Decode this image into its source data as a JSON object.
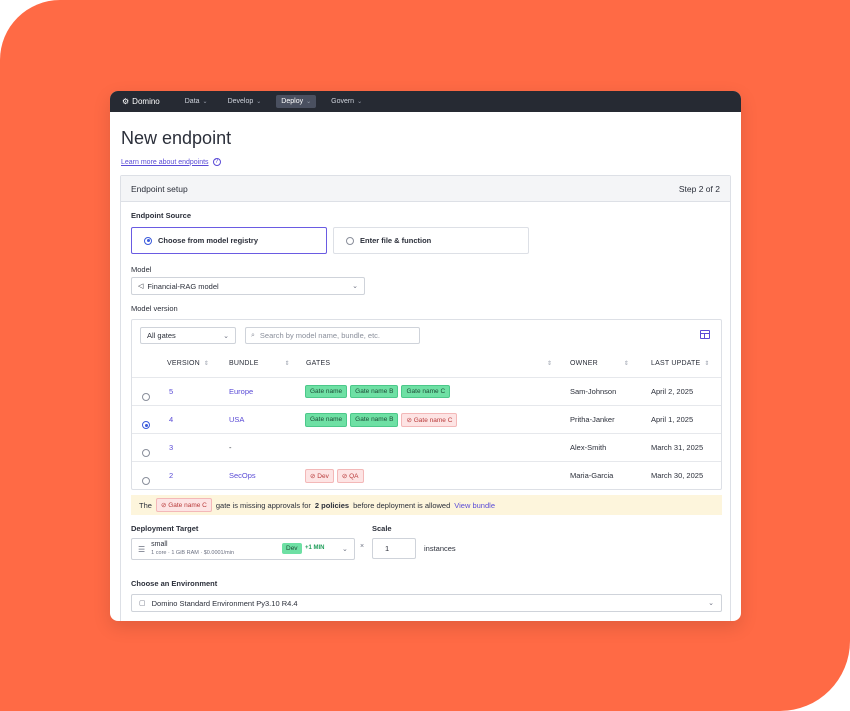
{
  "nav": {
    "brand": "Domino",
    "items": [
      {
        "label": "Data",
        "active": false
      },
      {
        "label": "Develop",
        "active": false
      },
      {
        "label": "Deploy",
        "active": true
      },
      {
        "label": "Govern",
        "active": false
      }
    ]
  },
  "page": {
    "title": "New endpoint",
    "learn_link": "Learn more about endpoints"
  },
  "panel": {
    "title": "Endpoint setup",
    "step": "Step 2 of 2"
  },
  "source": {
    "label": "Endpoint Source",
    "options": [
      {
        "label": "Choose from model registry",
        "selected": true
      },
      {
        "label": "Enter file & function",
        "selected": false
      }
    ]
  },
  "model": {
    "label": "Model",
    "value": "Financial-RAG model"
  },
  "version": {
    "label": "Model version",
    "filter": "All gates",
    "search_placeholder": "Search by model name, bundle, etc.",
    "columns": [
      "VERSION",
      "BUNDLE",
      "GATES",
      "OWNER",
      "LAST UPDATE"
    ],
    "rows": [
      {
        "version": "5",
        "bundle": "Europe",
        "owner": "Sam-Johnson",
        "updated": "April 2, 2025",
        "selected": false,
        "gates": [
          {
            "label": "Gate name",
            "status": "pass"
          },
          {
            "label": "Gate name B",
            "status": "pass"
          },
          {
            "label": "Gate name C",
            "status": "pass"
          }
        ]
      },
      {
        "version": "4",
        "bundle": "USA",
        "owner": "Pritha-Janker",
        "updated": "April 1, 2025",
        "selected": true,
        "gates": [
          {
            "label": "Gate name",
            "status": "pass"
          },
          {
            "label": "Gate name B",
            "status": "pass"
          },
          {
            "label": "Gate name C",
            "status": "blocked"
          }
        ]
      },
      {
        "version": "3",
        "bundle": "-",
        "owner": "Alex-Smith",
        "updated": "March 31, 2025",
        "selected": false,
        "gates": []
      },
      {
        "version": "2",
        "bundle": "SecOps",
        "owner": "Maria-Garcia",
        "updated": "March 30, 2025",
        "selected": false,
        "gates": [
          {
            "label": "Dev",
            "status": "blocked"
          },
          {
            "label": "QA",
            "status": "blocked"
          }
        ]
      }
    ]
  },
  "banner": {
    "prefix": "The",
    "gate": "Gate name C",
    "middle": "gate is missing approvals for",
    "bold": "2 policies",
    "suffix": "before deployment is allowed",
    "link": "View bundle"
  },
  "deployment": {
    "label": "Deployment Target",
    "name": "small",
    "spec": "1 core · 1 GiB RAM · $0.0001/min",
    "tag": "Dev",
    "min": "+1 MIN"
  },
  "scale": {
    "label": "Scale",
    "value": "1",
    "unit": "instances",
    "times": "×"
  },
  "environment": {
    "label": "Choose an Environment",
    "value": "Domino Standard Environment Py3.10 R4.4"
  }
}
